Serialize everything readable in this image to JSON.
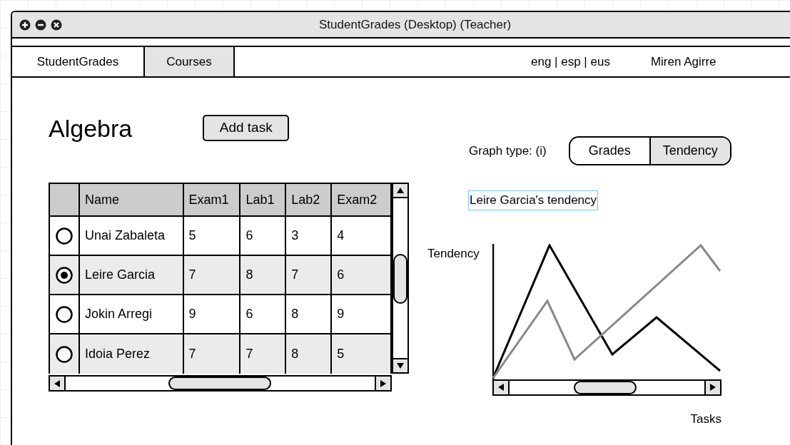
{
  "window": {
    "title": "StudentGrades (Desktop) (Teacher)"
  },
  "nav": {
    "tabs": [
      {
        "label": "StudentGrades",
        "selected": false
      },
      {
        "label": "Courses",
        "selected": true
      }
    ],
    "languages": "eng | esp | eus",
    "user": "Miren Agirre"
  },
  "course": {
    "title": "Algebra",
    "add_button": "Add task"
  },
  "table": {
    "columns": [
      "Name",
      "Exam1",
      "Lab1",
      "Lab2",
      "Exam2"
    ],
    "rows": [
      {
        "selected": false,
        "cells": [
          "Unai Zabaleta",
          "5",
          "6",
          "3",
          "4"
        ]
      },
      {
        "selected": true,
        "cells": [
          "Leire Garcia",
          "7",
          "8",
          "7",
          "6"
        ]
      },
      {
        "selected": false,
        "cells": [
          "Jokin Arregi",
          "9",
          "6",
          "8",
          "9"
        ]
      },
      {
        "selected": false,
        "cells": [
          "Idoia Perez",
          "7",
          "7",
          "8",
          "5"
        ]
      }
    ]
  },
  "graph": {
    "type_label": "Graph type: (i)",
    "types": [
      {
        "label": "Grades",
        "selected": false
      },
      {
        "label": "Tendency",
        "selected": true
      }
    ],
    "title": "Leire Garcia's tendency",
    "ylabel": "Tendency",
    "xlabel": "Tasks"
  }
}
